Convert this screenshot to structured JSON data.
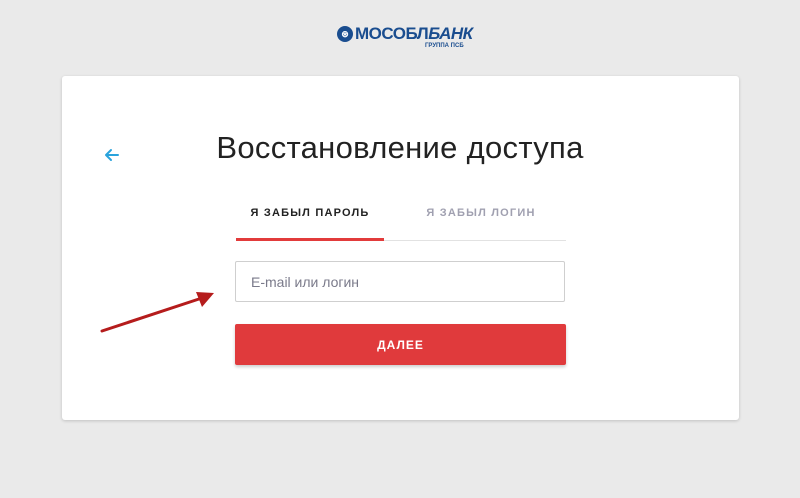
{
  "logo": {
    "mark": "⊛",
    "name_part1": "МОСОБЛ",
    "name_part2": "БАНК",
    "subtitle": "ГРУППА ПСБ"
  },
  "page": {
    "title": "Восстановление доступа"
  },
  "tabs": [
    {
      "label": "Я ЗАБЫЛ ПАРОЛЬ",
      "active": true
    },
    {
      "label": "Я ЗАБЫЛ ЛОГИН",
      "active": false
    }
  ],
  "form": {
    "login_placeholder": "E-mail или логин",
    "submit_label": "ДАЛЕЕ"
  },
  "colors": {
    "accent": "#e03a3c",
    "back_arrow": "#2aa3dc",
    "annotation_arrow": "#b51c1c",
    "brand": "#1a4d8f"
  },
  "icons": {
    "back": "arrow-left-icon",
    "annotation": "annotation-arrow-icon"
  }
}
